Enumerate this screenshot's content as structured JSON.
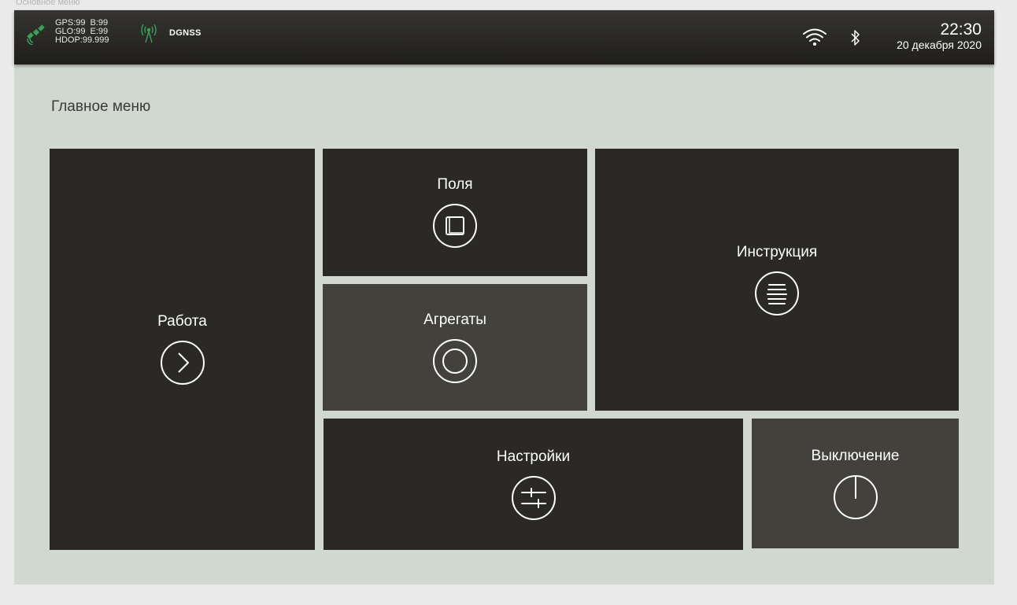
{
  "frame_label": "Основное меню",
  "statusbar": {
    "gps_line1": [
      "GPS:99",
      "B:99"
    ],
    "gps_line2": [
      "GLO:99",
      "E:99"
    ],
    "gps_line3": [
      "HDOP:99.999"
    ],
    "correction": "DGNSS",
    "time": "22:30",
    "date": "20 декабря 2020",
    "icons": {
      "satellite": "satellite-icon",
      "antenna": "antenna-icon",
      "wifi": "wifi-icon",
      "bluetooth": "bluetooth-icon"
    },
    "satellite_color": "#3aa05a"
  },
  "main": {
    "title": "Главное меню",
    "tiles": {
      "work": {
        "label": "Работа",
        "icon": "chevron-right-icon"
      },
      "fields": {
        "label": "Поля",
        "icon": "square-icon"
      },
      "units": {
        "label": "Агрегаты",
        "icon": "ring-icon"
      },
      "manual": {
        "label": "Инструкция",
        "icon": "list-lines-icon"
      },
      "settings": {
        "label": "Настройки",
        "icon": "sliders-icon"
      },
      "shutdown": {
        "label": "Выключение",
        "icon": "power-icon"
      }
    }
  },
  "colors": {
    "tile_dark": "#2b2926",
    "tile_selected": "#43413c",
    "background": "#d1d8cf"
  }
}
